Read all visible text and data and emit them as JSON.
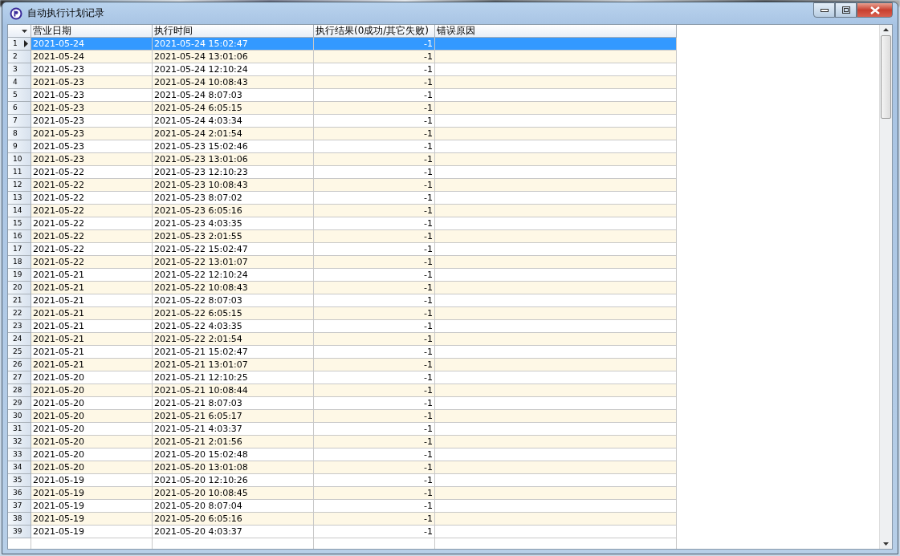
{
  "window": {
    "title": "自动执行计划记录"
  },
  "table": {
    "columns": [
      "营业日期",
      "执行时间",
      "执行结果(0成功/其它失败)",
      "错误原因"
    ],
    "rows": [
      {
        "number": "1",
        "date": "2021-05-24",
        "time": "2021-05-24 15:02:47",
        "result": "-1",
        "selected": true
      },
      {
        "number": "2",
        "date": "2021-05-24",
        "time": "2021-05-24 13:01:06",
        "result": "-1",
        "selected": false
      },
      {
        "number": "3",
        "date": "2021-05-23",
        "time": "2021-05-24 12:10:24",
        "result": "-1",
        "selected": false
      },
      {
        "number": "4",
        "date": "2021-05-23",
        "time": "2021-05-24 10:08:43",
        "result": "-1",
        "selected": false
      },
      {
        "number": "5",
        "date": "2021-05-23",
        "time": "2021-05-24 8:07:03",
        "result": "-1",
        "selected": false
      },
      {
        "number": "6",
        "date": "2021-05-23",
        "time": "2021-05-24 6:05:15",
        "result": "-1",
        "selected": false
      },
      {
        "number": "7",
        "date": "2021-05-23",
        "time": "2021-05-24 4:03:34",
        "result": "-1",
        "selected": false
      },
      {
        "number": "8",
        "date": "2021-05-23",
        "time": "2021-05-24 2:01:54",
        "result": "-1",
        "selected": false
      },
      {
        "number": "9",
        "date": "2021-05-23",
        "time": "2021-05-23 15:02:46",
        "result": "-1",
        "selected": false
      },
      {
        "number": "10",
        "date": "2021-05-23",
        "time": "2021-05-23 13:01:06",
        "result": "-1",
        "selected": false
      },
      {
        "number": "11",
        "date": "2021-05-22",
        "time": "2021-05-23 12:10:23",
        "result": "-1",
        "selected": false
      },
      {
        "number": "12",
        "date": "2021-05-22",
        "time": "2021-05-23 10:08:43",
        "result": "-1",
        "selected": false
      },
      {
        "number": "13",
        "date": "2021-05-22",
        "time": "2021-05-23 8:07:02",
        "result": "-1",
        "selected": false
      },
      {
        "number": "14",
        "date": "2021-05-22",
        "time": "2021-05-23 6:05:16",
        "result": "-1",
        "selected": false
      },
      {
        "number": "15",
        "date": "2021-05-22",
        "time": "2021-05-23 4:03:35",
        "result": "-1",
        "selected": false
      },
      {
        "number": "16",
        "date": "2021-05-22",
        "time": "2021-05-23 2:01:55",
        "result": "-1",
        "selected": false
      },
      {
        "number": "17",
        "date": "2021-05-22",
        "time": "2021-05-22 15:02:47",
        "result": "-1",
        "selected": false
      },
      {
        "number": "18",
        "date": "2021-05-22",
        "time": "2021-05-22 13:01:07",
        "result": "-1",
        "selected": false
      },
      {
        "number": "19",
        "date": "2021-05-21",
        "time": "2021-05-22 12:10:24",
        "result": "-1",
        "selected": false
      },
      {
        "number": "20",
        "date": "2021-05-21",
        "time": "2021-05-22 10:08:43",
        "result": "-1",
        "selected": false
      },
      {
        "number": "21",
        "date": "2021-05-21",
        "time": "2021-05-22 8:07:03",
        "result": "-1",
        "selected": false
      },
      {
        "number": "22",
        "date": "2021-05-21",
        "time": "2021-05-22 6:05:15",
        "result": "-1",
        "selected": false
      },
      {
        "number": "23",
        "date": "2021-05-21",
        "time": "2021-05-22 4:03:35",
        "result": "-1",
        "selected": false
      },
      {
        "number": "24",
        "date": "2021-05-21",
        "time": "2021-05-22 2:01:54",
        "result": "-1",
        "selected": false
      },
      {
        "number": "25",
        "date": "2021-05-21",
        "time": "2021-05-21 15:02:47",
        "result": "-1",
        "selected": false
      },
      {
        "number": "26",
        "date": "2021-05-21",
        "time": "2021-05-21 13:01:07",
        "result": "-1",
        "selected": false
      },
      {
        "number": "27",
        "date": "2021-05-20",
        "time": "2021-05-21 12:10:25",
        "result": "-1",
        "selected": false
      },
      {
        "number": "28",
        "date": "2021-05-20",
        "time": "2021-05-21 10:08:44",
        "result": "-1",
        "selected": false
      },
      {
        "number": "29",
        "date": "2021-05-20",
        "time": "2021-05-21 8:07:03",
        "result": "-1",
        "selected": false
      },
      {
        "number": "30",
        "date": "2021-05-20",
        "time": "2021-05-21 6:05:17",
        "result": "-1",
        "selected": false
      },
      {
        "number": "31",
        "date": "2021-05-20",
        "time": "2021-05-21 4:03:37",
        "result": "-1",
        "selected": false
      },
      {
        "number": "32",
        "date": "2021-05-20",
        "time": "2021-05-21 2:01:56",
        "result": "-1",
        "selected": false
      },
      {
        "number": "33",
        "date": "2021-05-20",
        "time": "2021-05-20 15:02:48",
        "result": "-1",
        "selected": false
      },
      {
        "number": "34",
        "date": "2021-05-20",
        "time": "2021-05-20 13:01:08",
        "result": "-1",
        "selected": false
      },
      {
        "number": "35",
        "date": "2021-05-19",
        "time": "2021-05-20 12:10:26",
        "result": "-1",
        "selected": false
      },
      {
        "number": "36",
        "date": "2021-05-19",
        "time": "2021-05-20 10:08:45",
        "result": "-1",
        "selected": false
      },
      {
        "number": "37",
        "date": "2021-05-19",
        "time": "2021-05-20 8:07:04",
        "result": "-1",
        "selected": false
      },
      {
        "number": "38",
        "date": "2021-05-19",
        "time": "2021-05-20 6:05:16",
        "result": "-1",
        "selected": false
      },
      {
        "number": "39",
        "date": "2021-05-19",
        "time": "2021-05-20 4:03:37",
        "result": "-1",
        "selected": false
      }
    ]
  }
}
